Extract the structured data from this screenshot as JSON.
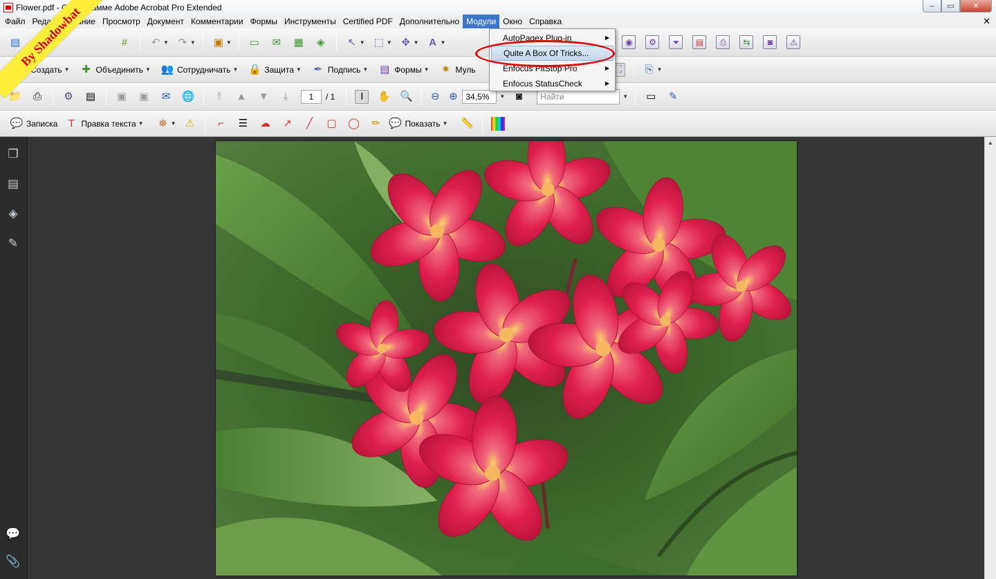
{
  "window": {
    "title": "Flower.pdf - О программе Adobe Acrobat Pro Extended",
    "controls": {
      "minimize": "–",
      "maximize": "▭",
      "close": "✕"
    }
  },
  "menubar": {
    "items": [
      "Файл",
      "Редактирование",
      "Просмотр",
      "Документ",
      "Комментарии",
      "Формы",
      "Инструменты",
      "Certified PDF",
      "Дополнительно",
      "Модули",
      "Окно",
      "Справка"
    ],
    "active": "Модули",
    "doc_close": "✕"
  },
  "dropdown": {
    "items": [
      {
        "label": "AutoPagex Plug-in",
        "submenu": true
      },
      {
        "label": "Quite A Box Of Tricks...",
        "submenu": false,
        "highlighted": true
      },
      {
        "label": "Enfocus PitStop Pro",
        "submenu": true
      },
      {
        "label": "Enfocus StatusCheck",
        "submenu": true
      }
    ],
    "highlight_color": "#c4d7ee",
    "annotation_color": "#e00000"
  },
  "toolbar2": {
    "create": "Создать",
    "combine": "Объединить",
    "collaborate": "Сотрудничать",
    "protect": "Защита",
    "sign": "Подпись",
    "forms": "Формы",
    "multimedia": "Муль"
  },
  "toolbar3": {
    "page_current": "1",
    "page_total": "/ 1",
    "zoom": "34,5%",
    "find_placeholder": "Найти"
  },
  "toolbar4": {
    "note": "Записка",
    "text_edit": "Правка текста",
    "show": "Показать"
  },
  "watermark": {
    "text": "By Shadowbat",
    "color": "#ffef3c",
    "text_color": "#d4001b"
  },
  "colors": {
    "menu_active": "#3d77cc",
    "workspace": "#353535",
    "left_panel": "#2c2c2c"
  }
}
